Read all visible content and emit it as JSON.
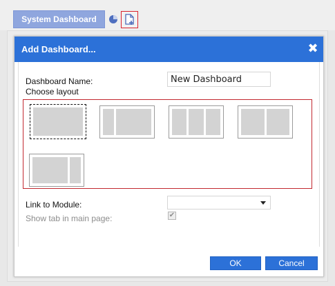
{
  "topbar": {
    "tab_label": "System Dashboard",
    "pie_icon": "pie-chart-icon",
    "add_icon": "add-dashboard-icon",
    "colors": {
      "tab": "#8fa6de",
      "add_outline": "#d9232e"
    }
  },
  "dialog": {
    "title": "Add Dashboard...",
    "close_icon": "close-icon",
    "header_color": "#2c71d8",
    "name_label": "Dashboard Name:",
    "name_value": "New Dashboard",
    "layout_label": "Choose layout",
    "layouts": [
      {
        "id": "single",
        "selected": true
      },
      {
        "id": "two-columns-narrow-left",
        "selected": false
      },
      {
        "id": "three-columns",
        "selected": false
      },
      {
        "id": "two-columns-equal",
        "selected": false
      },
      {
        "id": "two-columns-narrow-right",
        "selected": false
      }
    ],
    "link_label": "Link to Module:",
    "link_value": "",
    "show_tab_label": "Show tab in main page:",
    "show_tab_checked": true,
    "ok_label": "OK",
    "cancel_label": "Cancel"
  }
}
